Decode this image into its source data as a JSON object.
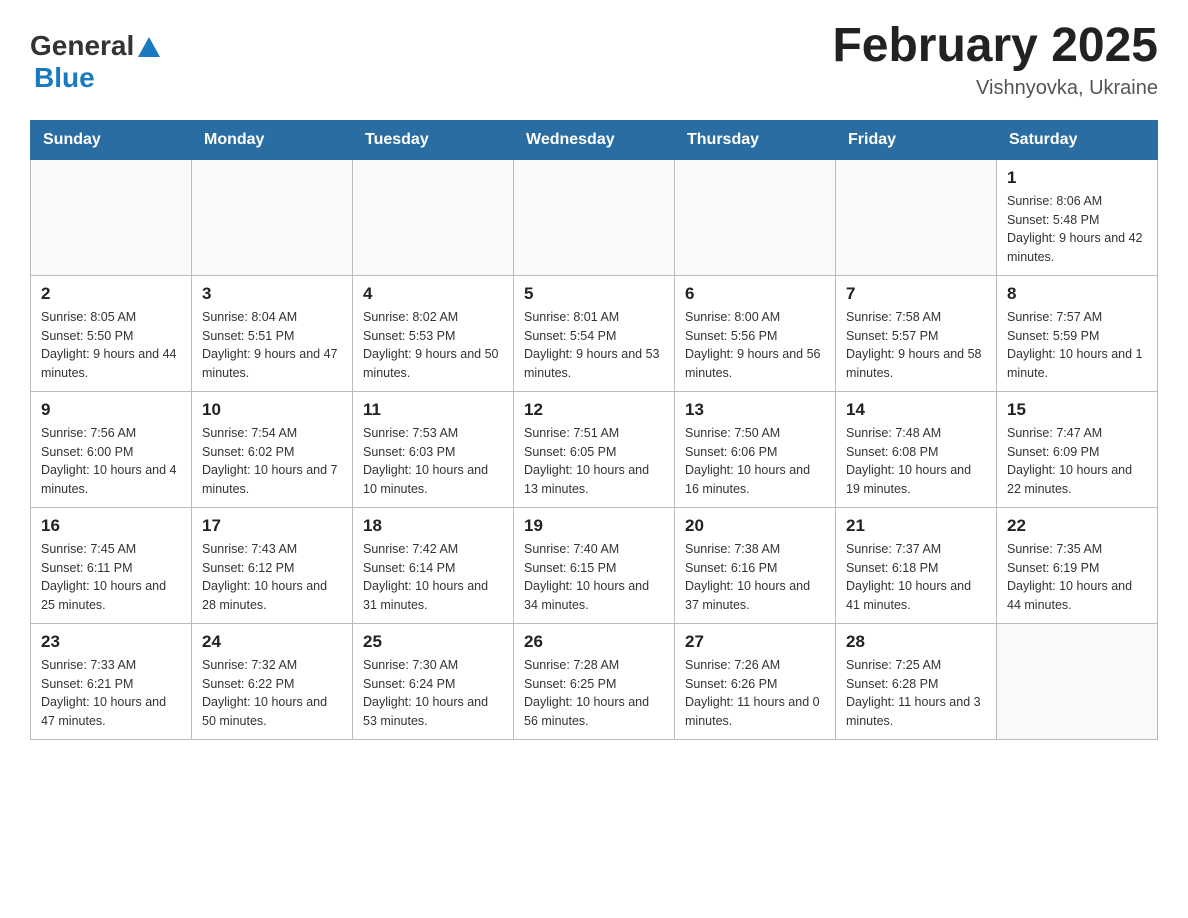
{
  "header": {
    "logo_general": "General",
    "logo_blue": "Blue",
    "month_title": "February 2025",
    "location": "Vishnyovka, Ukraine"
  },
  "days_of_week": [
    "Sunday",
    "Monday",
    "Tuesday",
    "Wednesday",
    "Thursday",
    "Friday",
    "Saturday"
  ],
  "weeks": [
    [
      {
        "day": "",
        "info": ""
      },
      {
        "day": "",
        "info": ""
      },
      {
        "day": "",
        "info": ""
      },
      {
        "day": "",
        "info": ""
      },
      {
        "day": "",
        "info": ""
      },
      {
        "day": "",
        "info": ""
      },
      {
        "day": "1",
        "info": "Sunrise: 8:06 AM\nSunset: 5:48 PM\nDaylight: 9 hours and 42 minutes."
      }
    ],
    [
      {
        "day": "2",
        "info": "Sunrise: 8:05 AM\nSunset: 5:50 PM\nDaylight: 9 hours and 44 minutes."
      },
      {
        "day": "3",
        "info": "Sunrise: 8:04 AM\nSunset: 5:51 PM\nDaylight: 9 hours and 47 minutes."
      },
      {
        "day": "4",
        "info": "Sunrise: 8:02 AM\nSunset: 5:53 PM\nDaylight: 9 hours and 50 minutes."
      },
      {
        "day": "5",
        "info": "Sunrise: 8:01 AM\nSunset: 5:54 PM\nDaylight: 9 hours and 53 minutes."
      },
      {
        "day": "6",
        "info": "Sunrise: 8:00 AM\nSunset: 5:56 PM\nDaylight: 9 hours and 56 minutes."
      },
      {
        "day": "7",
        "info": "Sunrise: 7:58 AM\nSunset: 5:57 PM\nDaylight: 9 hours and 58 minutes."
      },
      {
        "day": "8",
        "info": "Sunrise: 7:57 AM\nSunset: 5:59 PM\nDaylight: 10 hours and 1 minute."
      }
    ],
    [
      {
        "day": "9",
        "info": "Sunrise: 7:56 AM\nSunset: 6:00 PM\nDaylight: 10 hours and 4 minutes."
      },
      {
        "day": "10",
        "info": "Sunrise: 7:54 AM\nSunset: 6:02 PM\nDaylight: 10 hours and 7 minutes."
      },
      {
        "day": "11",
        "info": "Sunrise: 7:53 AM\nSunset: 6:03 PM\nDaylight: 10 hours and 10 minutes."
      },
      {
        "day": "12",
        "info": "Sunrise: 7:51 AM\nSunset: 6:05 PM\nDaylight: 10 hours and 13 minutes."
      },
      {
        "day": "13",
        "info": "Sunrise: 7:50 AM\nSunset: 6:06 PM\nDaylight: 10 hours and 16 minutes."
      },
      {
        "day": "14",
        "info": "Sunrise: 7:48 AM\nSunset: 6:08 PM\nDaylight: 10 hours and 19 minutes."
      },
      {
        "day": "15",
        "info": "Sunrise: 7:47 AM\nSunset: 6:09 PM\nDaylight: 10 hours and 22 minutes."
      }
    ],
    [
      {
        "day": "16",
        "info": "Sunrise: 7:45 AM\nSunset: 6:11 PM\nDaylight: 10 hours and 25 minutes."
      },
      {
        "day": "17",
        "info": "Sunrise: 7:43 AM\nSunset: 6:12 PM\nDaylight: 10 hours and 28 minutes."
      },
      {
        "day": "18",
        "info": "Sunrise: 7:42 AM\nSunset: 6:14 PM\nDaylight: 10 hours and 31 minutes."
      },
      {
        "day": "19",
        "info": "Sunrise: 7:40 AM\nSunset: 6:15 PM\nDaylight: 10 hours and 34 minutes."
      },
      {
        "day": "20",
        "info": "Sunrise: 7:38 AM\nSunset: 6:16 PM\nDaylight: 10 hours and 37 minutes."
      },
      {
        "day": "21",
        "info": "Sunrise: 7:37 AM\nSunset: 6:18 PM\nDaylight: 10 hours and 41 minutes."
      },
      {
        "day": "22",
        "info": "Sunrise: 7:35 AM\nSunset: 6:19 PM\nDaylight: 10 hours and 44 minutes."
      }
    ],
    [
      {
        "day": "23",
        "info": "Sunrise: 7:33 AM\nSunset: 6:21 PM\nDaylight: 10 hours and 47 minutes."
      },
      {
        "day": "24",
        "info": "Sunrise: 7:32 AM\nSunset: 6:22 PM\nDaylight: 10 hours and 50 minutes."
      },
      {
        "day": "25",
        "info": "Sunrise: 7:30 AM\nSunset: 6:24 PM\nDaylight: 10 hours and 53 minutes."
      },
      {
        "day": "26",
        "info": "Sunrise: 7:28 AM\nSunset: 6:25 PM\nDaylight: 10 hours and 56 minutes."
      },
      {
        "day": "27",
        "info": "Sunrise: 7:26 AM\nSunset: 6:26 PM\nDaylight: 11 hours and 0 minutes."
      },
      {
        "day": "28",
        "info": "Sunrise: 7:25 AM\nSunset: 6:28 PM\nDaylight: 11 hours and 3 minutes."
      },
      {
        "day": "",
        "info": ""
      }
    ]
  ]
}
